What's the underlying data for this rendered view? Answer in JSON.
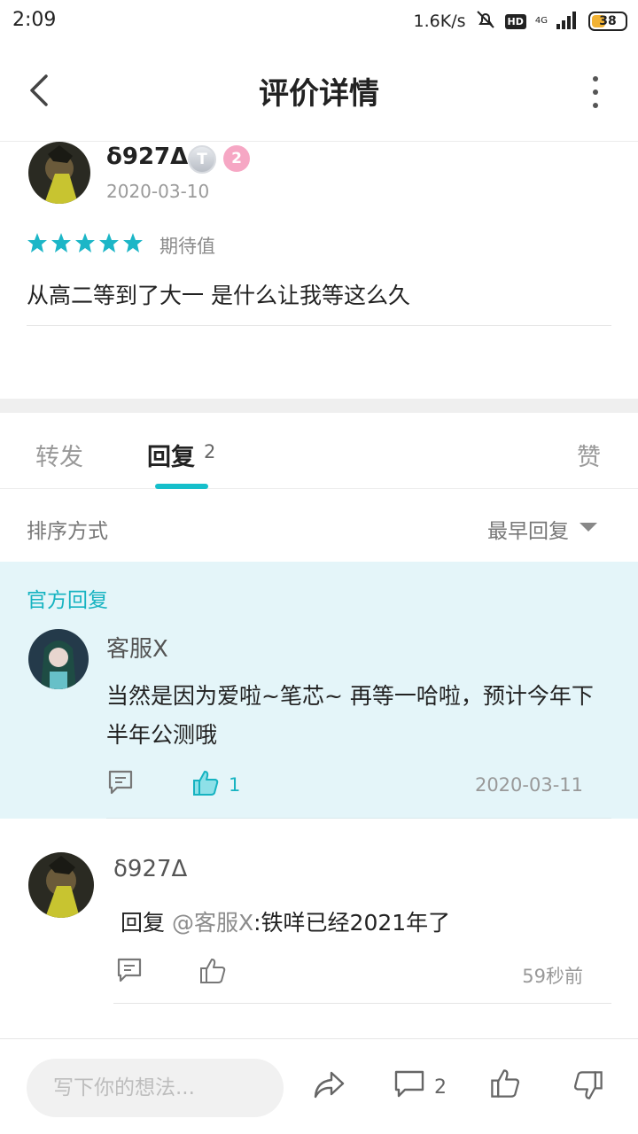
{
  "status_bar": {
    "time": "2:09",
    "net_speed": "1.6K/s",
    "hd": "HD",
    "network": "4G",
    "battery": "38"
  },
  "header": {
    "title": "评价详情"
  },
  "review": {
    "user_name": "δ927Δ",
    "badge_level": "2",
    "date": "2020-03-10",
    "stars": 5,
    "rating_label": "期待值",
    "text": "从高二等到了大一 是什么让我等这么久"
  },
  "tabs": {
    "forward": "转发",
    "reply": "回复",
    "reply_count": "2",
    "like": "赞"
  },
  "sort": {
    "label": "排序方式",
    "value": "最早回复"
  },
  "official_reply": {
    "section_title": "官方回复",
    "name": "客服X",
    "text": "当然是因为爱啦~笔芯~ 再等一哈啦，预计今年下半年公测哦",
    "like_count": "1",
    "date": "2020-03-11"
  },
  "user_reply": {
    "name": "δ927Δ",
    "prefix": "回复",
    "mention": "@客服X",
    "text": ":铁咩已经2021年了",
    "time_ago": "59秒前"
  },
  "bottom_bar": {
    "placeholder": "写下你的想法...",
    "comment_count": "2"
  },
  "colors": {
    "accent": "#16bfcb",
    "star": "#1cb6c7",
    "official_bg": "#e4f5f9"
  },
  "icons": [
    "back-icon",
    "more-icon",
    "star-icon",
    "comment-icon",
    "like-icon",
    "share-icon",
    "dislike-icon"
  ]
}
